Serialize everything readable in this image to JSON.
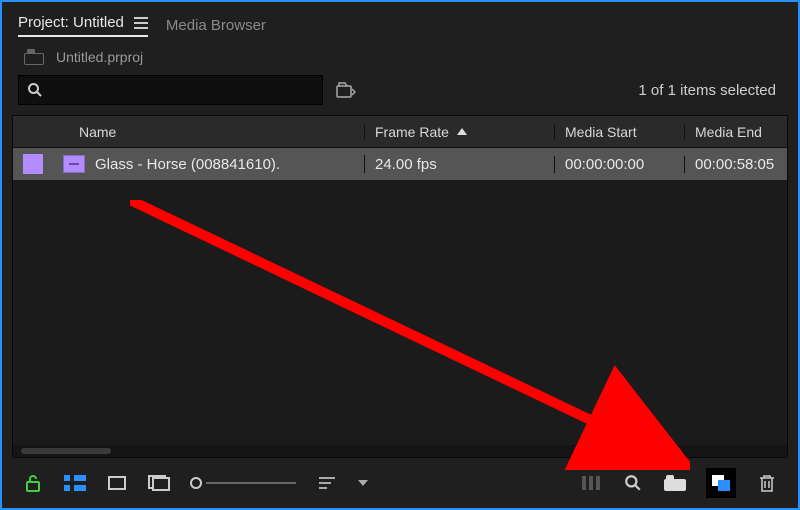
{
  "tabs": {
    "project": "Project: Untitled",
    "media_browser": "Media Browser"
  },
  "project_file": "Untitled.prproj",
  "selection_status": "1 of 1 items selected",
  "columns": {
    "name": "Name",
    "frame_rate": "Frame Rate",
    "media_start": "Media Start",
    "media_end": "Media End"
  },
  "items": [
    {
      "name": "Glass - Horse (008841610).",
      "frame_rate": "24.00 fps",
      "media_start": "00:00:00:00",
      "media_end": "00:00:58:05"
    }
  ],
  "icons": {
    "panel_menu": "panel-menu-icon",
    "search": "search-icon",
    "filter": "filter-bin-icon",
    "lock": "lock-open-icon",
    "list_view": "list-view-icon",
    "icon_view": "icon-view-icon",
    "freeform": "freeform-view-icon",
    "zoom_slider": "zoom-slider",
    "sort": "sort-icon",
    "automate": "automate-to-sequence-icon",
    "find": "find-icon",
    "new_bin": "new-bin-icon",
    "new_item": "new-item-icon",
    "clear": "trash-icon"
  }
}
